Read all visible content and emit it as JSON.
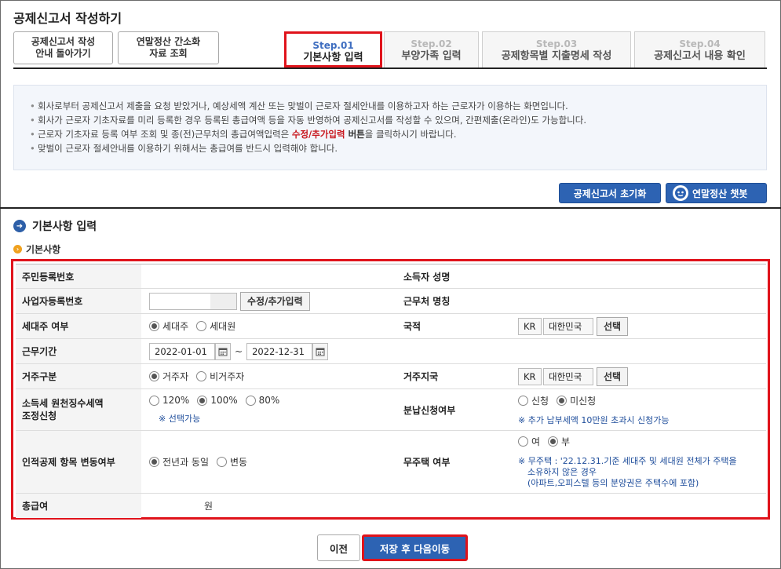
{
  "page_title": "공제신고서 작성하기",
  "top_buttons": [
    {
      "line1": "공제신고서 작성",
      "line2": "안내 돌아가기"
    },
    {
      "line1": "연말정산 간소화",
      "line2": "자료 조회"
    }
  ],
  "steps": [
    {
      "num": "Step.01",
      "label": "기본사항 입력",
      "active": true
    },
    {
      "num": "Step.02",
      "label": "부양가족 입력",
      "active": false
    },
    {
      "num": "Step.03",
      "label": "공제항목별 지출명세 작성",
      "active": false
    },
    {
      "num": "Step.04",
      "label": "공제신고서 내용 확인",
      "active": false
    }
  ],
  "info": {
    "line1": "회사로부터 공제신고서 제출을 요청 받았거나, 예상세액 계산 또는 맞벌이 근로자 절세안내를 이용하고자 하는 근로자가 이용하는 화면입니다.",
    "line2": "회사가 근로자 기초자료를 미리 등록한 경우 등록된 총급여액 등을 자동 반영하여 공제신고서를 작성할 수 있으며, 간편제출(온라인)도 가능합니다.",
    "line3_pre": "근로자 기초자료 등록 여부 조회 및 종(전)근무처의 총급여액입력은 ",
    "line3_red": "수정/추가입력",
    "line3_bold": " 버튼",
    "line3_post": "을 클릭하시기 바랍니다.",
    "line4": "맞벌이 근로자 절세안내를 이용하기 위해서는 총급여를 반드시 입력해야 합니다."
  },
  "actions": {
    "reset": "공제신고서 초기화",
    "chatbot": "연말정산 챗봇"
  },
  "section_title": "기본사항 입력",
  "sub_title": "기본사항",
  "form": {
    "resident_no_label": "주민등록번호",
    "name_label": "소득자 성명",
    "biz_no_label": "사업자등록번호",
    "biz_edit_btn": "수정/추가입력",
    "workplace_label": "근무처 명칭",
    "householder_label": "세대주 여부",
    "householder_opt1": "세대주",
    "householder_opt2": "세대원",
    "nationality_label": "국적",
    "nation_code": "KR",
    "nation_name": "대한민국",
    "select_btn": "선택",
    "period_label": "근무기간",
    "period_from": "2022-01-01",
    "period_sep": "~",
    "period_to": "2022-12-31",
    "residency_label": "거주구분",
    "residency_opt1": "거주자",
    "residency_opt2": "비거주자",
    "res_region_label": "거주지국",
    "res_code": "KR",
    "res_name": "대한민국",
    "res_select_btn": "선택",
    "withhold_label_1": "소득세 원천징수세액",
    "withhold_label_2": "조정신청",
    "withhold_opt1": "120%",
    "withhold_opt2": "100%",
    "withhold_opt3": "80%",
    "withhold_note": "※ 선택가능",
    "install_label": "분납신청여부",
    "install_opt1": "신청",
    "install_opt2": "미신청",
    "install_note": "※ 추가 납부세액 10만원 초과시 신청가능",
    "deduction_change_label": "인적공제 항목 변동여부",
    "deduction_opt1": "전년과 동일",
    "deduction_opt2": "변동",
    "nohouse_label": "무주택 여부",
    "nohouse_opt1": "여",
    "nohouse_opt2": "부",
    "nohouse_note1": "※ 무주택 : '22.12.31.기준 세대주 및 세대원 전체가 주택을",
    "nohouse_note2": "소유하지 않은 경우",
    "nohouse_note3": "(아파트,오피스텔 등의 분양권은 주택수에 포함)",
    "total_pay_label": "총급여",
    "total_pay_unit": "원"
  },
  "bottom": {
    "prev": "이전",
    "next": "저장 후 다음이동"
  }
}
